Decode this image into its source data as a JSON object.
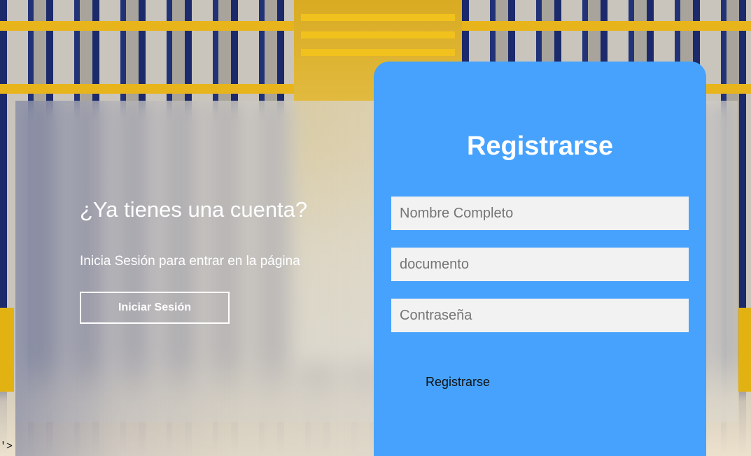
{
  "login_panel": {
    "heading": "¿Ya tienes una cuenta?",
    "subtext": "Inicia Sesión para entrar en la página",
    "login_button": "Iniciar Sesión"
  },
  "register_form": {
    "title": "Registrarse",
    "fields": {
      "full_name_placeholder": "Nombre Completo",
      "document_placeholder": "documento",
      "password_placeholder": "Contraseña"
    },
    "submit_label": "Registrarse"
  },
  "stray_text": "'>",
  "colors": {
    "card_bg": "#46a2fd",
    "input_bg": "#f2f2f2",
    "text_light": "#ffffff"
  }
}
